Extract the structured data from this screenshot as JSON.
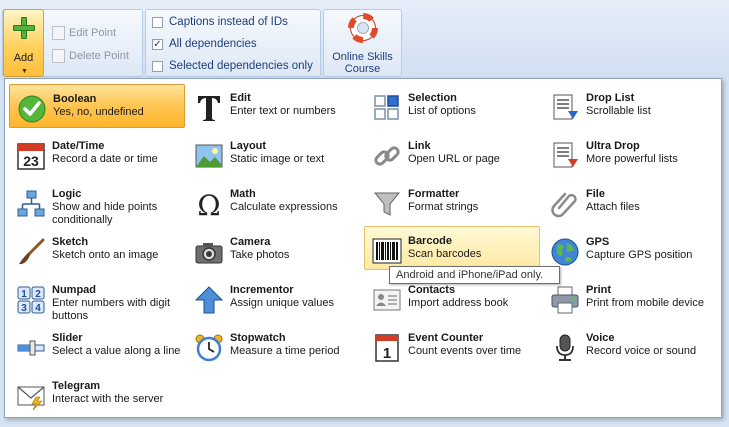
{
  "ribbon": {
    "add_label": "Add",
    "edit_point": "Edit Point",
    "delete_point": "Delete Point",
    "options": [
      {
        "label": "Captions instead of IDs",
        "checked": false
      },
      {
        "label": "All dependencies",
        "checked": true
      },
      {
        "label": "Selected dependencies only",
        "checked": false
      }
    ],
    "online_skills": {
      "line1": "Online Skills",
      "line2": "Course"
    }
  },
  "menu": {
    "items": [
      {
        "title": "Boolean",
        "desc": "Yes, no, undefined",
        "icon": "check-circle-icon",
        "state": "selected"
      },
      {
        "title": "Edit",
        "desc": "Enter text or numbers",
        "icon": "text-t-icon"
      },
      {
        "title": "Selection",
        "desc": "List of options",
        "icon": "selection-grid-icon"
      },
      {
        "title": "Drop List",
        "desc": "Scrollable list",
        "icon": "drop-list-icon"
      },
      {
        "title": "Date/Time",
        "desc": "Record a date or time",
        "icon": "calendar-icon"
      },
      {
        "title": "Layout",
        "desc": "Static image or text",
        "icon": "picture-icon"
      },
      {
        "title": "Link",
        "desc": "Open URL or page",
        "icon": "chain-link-icon"
      },
      {
        "title": "Ultra Drop",
        "desc": "More powerful lists",
        "icon": "ultra-drop-icon"
      },
      {
        "title": "Logic",
        "desc": "Show and hide points conditionally",
        "icon": "logic-tree-icon"
      },
      {
        "title": "Math",
        "desc": "Calculate expressions",
        "icon": "omega-icon"
      },
      {
        "title": "Formatter",
        "desc": "Format strings",
        "icon": "funnel-icon"
      },
      {
        "title": "File",
        "desc": "Attach files",
        "icon": "paperclip-icon"
      },
      {
        "title": "Sketch",
        "desc": "Sketch onto an image",
        "icon": "paintbrush-icon"
      },
      {
        "title": "Camera",
        "desc": "Take photos",
        "icon": "camera-icon"
      },
      {
        "title": "Barcode",
        "desc": "Scan barcodes",
        "icon": "barcode-icon",
        "state": "hover"
      },
      {
        "title": "GPS",
        "desc": "Capture GPS position",
        "icon": "globe-icon"
      },
      {
        "title": "Numpad",
        "desc": "Enter numbers with digit buttons",
        "icon": "numpad-icon"
      },
      {
        "title": "Incrementor",
        "desc": "Assign unique values",
        "icon": "up-arrow-icon"
      },
      {
        "title": "Contacts",
        "desc": "Import address book",
        "icon": "contact-card-icon"
      },
      {
        "title": "Print",
        "desc": "Print from mobile device",
        "icon": "printer-icon"
      },
      {
        "title": "Slider",
        "desc": "Select a value along a line",
        "icon": "slider-icon"
      },
      {
        "title": "Stopwatch",
        "desc": "Measure a time period",
        "icon": "alarm-clock-icon"
      },
      {
        "title": "Event Counter",
        "desc": "Count events over time",
        "icon": "counter-icon"
      },
      {
        "title": "Voice",
        "desc": "Record voice or sound",
        "icon": "microphone-icon"
      },
      {
        "title": "Telegram",
        "desc": "Interact with the server",
        "icon": "envelope-icon"
      }
    ],
    "calendar_day": "23",
    "counter_digit": "1",
    "numpad_digits": [
      "1",
      "2",
      "3",
      "4"
    ],
    "tooltip": "Android and iPhone/iPad only."
  }
}
